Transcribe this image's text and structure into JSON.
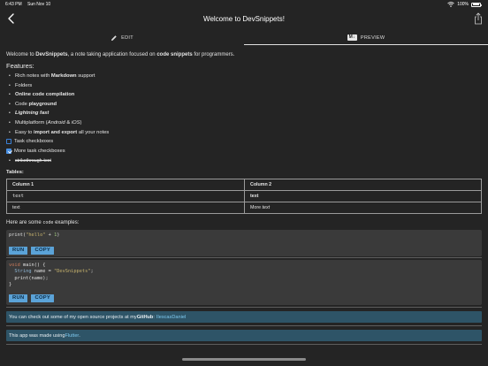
{
  "status": {
    "time": "6:43 PM",
    "date": "Sun Nov 10",
    "battery": "100%"
  },
  "nav": {
    "title": "Welcome to DevSnippets!"
  },
  "tabs": {
    "edit": "EDIT",
    "preview": "PREVIEW",
    "md_badge": "M↓"
  },
  "intro": {
    "pre": "Welcome to ",
    "app": "DevSnippets",
    "mid": ", a note taking application focused on ",
    "bold": "code snippets",
    "post": " for programmers."
  },
  "features_heading": "Features:",
  "features": {
    "f1_pre": "Rich notes with ",
    "f1_bold": "Markdown",
    "f1_post": " support",
    "f2": "Folders",
    "f3": "Online code compilation",
    "f4_pre": "Code ",
    "f4_bold": "playground",
    "f5": "Lightning fast",
    "f6_pre": "Multiplatform (",
    "f6_a": "Android",
    "f6_mid": " & ",
    "f6_b": "iOS",
    "f6_post": ")",
    "f7_pre": "Easy to ",
    "f7_bold": "import and export",
    "f7_post": " all your notes"
  },
  "tasks": {
    "t1": "Task checkboxes",
    "t2": "More task checkboxes"
  },
  "strike": "strikethrough-text",
  "tables_label": "Tables:",
  "table": {
    "h1": "Column 1",
    "h2": "Column 2",
    "r1c1": "text",
    "r1c2": "text",
    "r2c1": "text",
    "r2c2_pre": "More ",
    "r2c2_em": "text"
  },
  "code_label": {
    "pre": "Here are some ",
    "code": "code",
    "post": " examples:"
  },
  "code1": {
    "fn": "print",
    "open": "(",
    "str": "\"hello\"",
    "op": " + ",
    "num": "1",
    "close": ")"
  },
  "code2": {
    "l1_kw": "void",
    "l1_rest": " main() {",
    "l2_ty": "String",
    "l2_mid": " name = ",
    "l2_str": "\"DevSnippets\"",
    "l2_end": ";",
    "l3": "print(name);",
    "l4": "}"
  },
  "buttons": {
    "run": "RUN",
    "copy": "COPY"
  },
  "note1": {
    "text": "You can check out some of my open source projects at my ",
    "bold": "GitHub",
    "sep": ":",
    "link": "IlescasDaniel"
  },
  "note2": {
    "text": "This app was made using ",
    "link": "Flutter",
    "end": "."
  },
  "colors": {
    "background": "#242424",
    "button": "#5ba3d8",
    "note_bg": "#2e5467",
    "link": "#7fc9ef",
    "checkbox": "#4a90e2"
  },
  "icons": {
    "back": "chevron-left-icon",
    "share": "share-icon",
    "edit": "pencil-icon",
    "wifi": "wifi-icon",
    "battery": "battery-icon"
  }
}
